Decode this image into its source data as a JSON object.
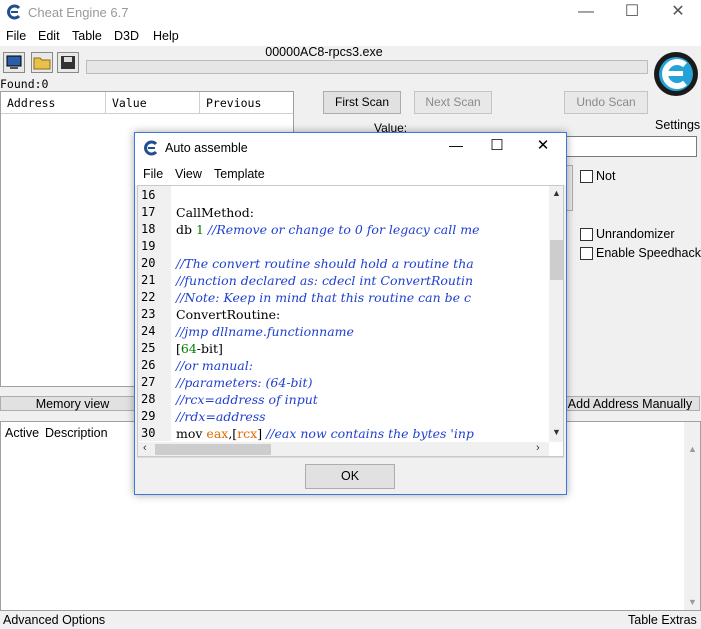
{
  "window": {
    "title": "Cheat Engine 6.7",
    "process_label": "00000AC8-rpcs3.exe"
  },
  "menu": [
    "File",
    "Edit",
    "Table",
    "D3D",
    "Help"
  ],
  "found_label": "Found:0",
  "results_table": {
    "columns": [
      "Address",
      "Value",
      "Previous"
    ]
  },
  "scan": {
    "first_scan": "First Scan",
    "next_scan": "Next Scan",
    "undo_scan": "Undo Scan",
    "value_label": "Value:",
    "not_label": "Not",
    "unrandomizer": "Unrandomizer",
    "speedhack": "Enable Speedhack"
  },
  "settings_label": "Settings",
  "memory_view_button": "Memory view",
  "add_address_button": "Add Address Manually",
  "addresslist": {
    "active_col": "Active",
    "description_col": "Description"
  },
  "status": {
    "left": "Advanced Options",
    "right": "Table Extras"
  },
  "dialog": {
    "title": "Auto assemble",
    "menu": [
      "File",
      "View",
      "Template"
    ],
    "ok": "OK",
    "lines": [
      {
        "n": "16",
        "parts": []
      },
      {
        "n": "17",
        "parts": [
          {
            "t": "CallMethod:",
            "c": "kw"
          }
        ]
      },
      {
        "n": "18",
        "parts": [
          {
            "t": "db ",
            "c": "kw"
          },
          {
            "t": "1",
            "c": "num"
          },
          {
            "t": " //Remove or change to 0 for legacy call me",
            "c": "cm"
          }
        ]
      },
      {
        "n": "19",
        "parts": []
      },
      {
        "n": "20",
        "parts": [
          {
            "t": "//The convert routine should hold a routine tha",
            "c": "cm"
          }
        ]
      },
      {
        "n": "21",
        "parts": [
          {
            "t": "//function declared as: cdecl int ConvertRoutin",
            "c": "cm"
          }
        ]
      },
      {
        "n": "22",
        "parts": [
          {
            "t": "//Note: Keep in mind that this routine can be c",
            "c": "cm"
          }
        ]
      },
      {
        "n": "23",
        "parts": [
          {
            "t": "ConvertRoutine:",
            "c": "kw"
          }
        ]
      },
      {
        "n": "24",
        "parts": [
          {
            "t": "//jmp dllname.functionname",
            "c": "cm"
          }
        ]
      },
      {
        "n": "25",
        "parts": [
          {
            "t": "[",
            "c": "kw"
          },
          {
            "t": "64",
            "c": "num"
          },
          {
            "t": "-bit]",
            "c": "kw"
          }
        ]
      },
      {
        "n": "26",
        "parts": [
          {
            "t": "//or manual:",
            "c": "cm"
          }
        ]
      },
      {
        "n": "27",
        "parts": [
          {
            "t": "//parameters: (64-bit)",
            "c": "cm"
          }
        ]
      },
      {
        "n": "28",
        "parts": [
          {
            "t": "//rcx=address of input",
            "c": "cm"
          }
        ]
      },
      {
        "n": "29",
        "parts": [
          {
            "t": "//rdx=address",
            "c": "cm"
          }
        ]
      },
      {
        "n": "30",
        "parts": [
          {
            "t": "mov ",
            "c": "kw"
          },
          {
            "t": "eax",
            "c": "reg"
          },
          {
            "t": ",[",
            "c": "kw"
          },
          {
            "t": "rcx",
            "c": "reg"
          },
          {
            "t": "] ",
            "c": "kw"
          },
          {
            "t": "//eax now contains the bytes 'inp",
            "c": "cm"
          }
        ]
      }
    ]
  }
}
